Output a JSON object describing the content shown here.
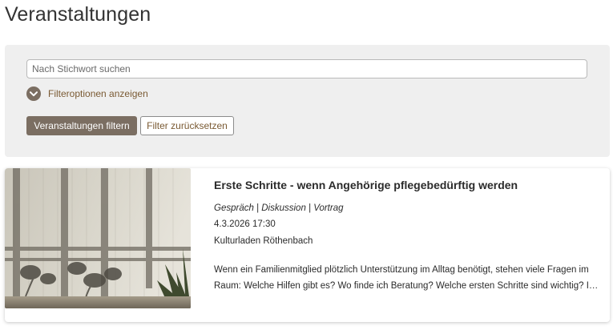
{
  "page": {
    "title": "Veranstaltungen"
  },
  "filters": {
    "search_placeholder": "Nach Stichwort suchen",
    "toggle_label": "Filteroptionen anzeigen",
    "apply_label": "Veranstaltungen filtern",
    "reset_label": "Filter zurücksetzen"
  },
  "event": {
    "title": "Erste Schritte - wenn Angehörige pflegebedürftig werden",
    "category": "Gespräch | Diskussion | Vortrag",
    "datetime": "4.3.2026 17:30",
    "location": "Kulturladen Röthenbach",
    "description": "Wenn ein Familienmitglied plötzlich Unterstützung im Alltag benötigt, stehen viele Fragen im Raum: Welche Hilfen gibt es? Wo finde ich Beratung? Welche ersten Schritte sind wichtig? In diesem Vortrag erhalten Sie einen Überblick."
  },
  "colors": {
    "accent": "#7b6e62",
    "link": "#7a5a33",
    "panel": "#efefef"
  },
  "icons": {
    "toggle": "chevron-down-icon"
  }
}
